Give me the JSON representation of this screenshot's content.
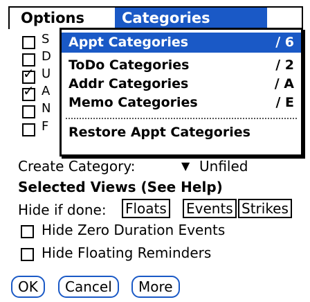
{
  "menubar": {
    "options": "Options",
    "categories": "Categories"
  },
  "dropdown": {
    "items": [
      {
        "label": "Appt Categories",
        "shortcut": "∕ 6"
      },
      {
        "label": "ToDo Categories",
        "shortcut": "∕ 2"
      },
      {
        "label": "Addr Categories",
        "shortcut": "∕ A"
      },
      {
        "label": "Memo Categories",
        "shortcut": "∕ E"
      },
      {
        "label": "Restore Appt Categories",
        "shortcut": ""
      }
    ]
  },
  "list_rows": [
    {
      "checked": false,
      "letter": "S"
    },
    {
      "checked": false,
      "letter": "D"
    },
    {
      "checked": true,
      "letter": "U"
    },
    {
      "checked": true,
      "letter": "A"
    },
    {
      "checked": false,
      "letter": "N"
    },
    {
      "checked": false,
      "letter": "F"
    }
  ],
  "create": {
    "label": "Create Category:",
    "arrow": "▼",
    "value": "Unfiled"
  },
  "views": {
    "heading": "Selected Views (See Help)"
  },
  "hide": {
    "label": "Hide if done:",
    "floats": "Floats",
    "events": "Events",
    "strikes": "Strikes"
  },
  "options": {
    "zero_duration": "Hide Zero Duration Events",
    "floating_reminders": "Hide Floating Reminders"
  },
  "buttons": {
    "ok": "OK",
    "cancel": "Cancel",
    "more": "More"
  },
  "colors": {
    "accent": "#1a59c6"
  }
}
